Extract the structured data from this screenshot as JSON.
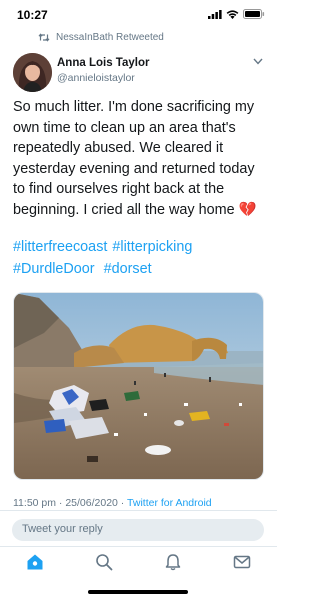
{
  "status": {
    "time": "10:27"
  },
  "retweet": {
    "label": "NessaInBath Retweeted"
  },
  "tweet": {
    "author_name": "Anna Lois Taylor",
    "author_handle": "@annieloistaylor",
    "text": "So much litter. I'm done sacrificing my own time to clean up an area that's repeatedly abused. We cleared it yesterday evening and returned today to find ourselves right back at the beginning. I cried all the way home 💔",
    "hashtags": [
      "#litterfreecoast",
      "#litterpicking",
      "#DurdleDoor",
      "#dorset"
    ],
    "timestamp": "11:50 pm · 25/06/2020 · ",
    "source": "Twitter for Android"
  },
  "reply": {
    "placeholder": "Tweet your reply"
  },
  "tabs": [
    "home-icon",
    "search-icon",
    "notifications-icon",
    "messages-icon"
  ],
  "colors": {
    "link": "#1da1f2",
    "secondary_text": "#657786",
    "primary_text": "#14171a"
  }
}
